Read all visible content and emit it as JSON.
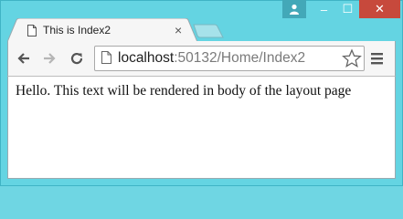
{
  "browser": {
    "tab": {
      "title": "This is Index2",
      "close_glyph": "×"
    },
    "window_controls": {
      "minimize_glyph": "–",
      "maximize_glyph": "☐",
      "close_glyph": "✕"
    },
    "address_bar": {
      "host": "localhost",
      "path": ":50132/Home/Index2"
    },
    "icons": {
      "back": "back-arrow-icon",
      "forward": "forward-arrow-icon",
      "reload": "reload-icon",
      "page": "page-icon",
      "bookmark": "star-icon",
      "menu": "hamburger-menu-icon",
      "profile": "user-profile-icon"
    }
  },
  "page": {
    "body_text": "Hello. This text will be rendered in body of the layout page"
  },
  "colors": {
    "frame": "#64d4e2",
    "close_button": "#c7493c",
    "toolbar": "#f6f6f6"
  }
}
